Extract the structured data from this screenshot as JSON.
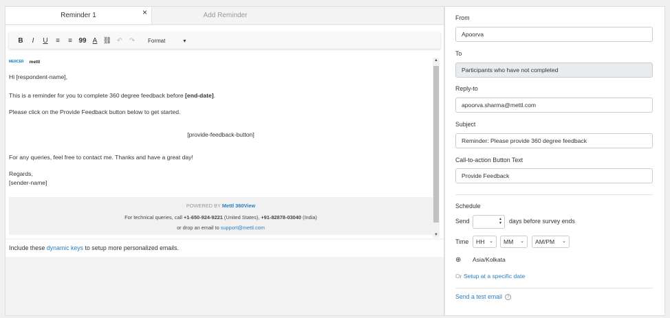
{
  "tabs": [
    {
      "label": "Reminder 1",
      "active": true
    },
    {
      "label": "Add Reminder",
      "active": false
    }
  ],
  "tab_close": "×",
  "toolbar": {
    "buttons": [
      "B",
      "I",
      "U",
      "≡",
      "≡",
      "99",
      "A",
      "⛓",
      "↶",
      "↷"
    ],
    "format_label": "Format",
    "format_chevron": "▾"
  },
  "email": {
    "logo_mercer": "MERCER",
    "logo_mettl": "mettl",
    "greeting": "Hi [respondent-name],",
    "line1_prefix": "This is a reminder for you to complete 360 degree feedback before ",
    "line1_bold": "[end-date]",
    "line1_suffix": ".",
    "line2": "Please click on the Provide Feedback button below to get started.",
    "button_placeholder": "[provide-feedback-button]",
    "line3": "For any queries, feel free to contact me. Thanks and have a great day!",
    "regards": "Regards,",
    "sender": "[sender-name]",
    "footer": {
      "powered_by": "POWERED BY ",
      "powered_brand": "Mettl 360View",
      "tech_prefix": "For technical queries, call ",
      "phone_us": "+1-650-924-9221",
      "us_label": " (United States), ",
      "phone_in": "+91-82878-03040",
      "in_label": " (India)",
      "drop_prefix": "or drop an email to ",
      "support_email": "support@mettl.com"
    }
  },
  "keys_hint": {
    "prefix": "Include these ",
    "link": "dynamic keys",
    "suffix": " to setup more personalized emails."
  },
  "form": {
    "from_label": "From",
    "from_value": "Apoorva",
    "to_label": "To",
    "to_value": "Participants who have not completed",
    "reply_label": "Reply-to",
    "reply_value": "apoorva.sharma@mettl.com",
    "subject_label": "Subject",
    "subject_value": "Reminder: Please provide 360 degree feedback",
    "cta_label": "Call-to-action Button Text",
    "cta_value": "Provide Feedback"
  },
  "schedule": {
    "title": "Schedule",
    "send_label": "Send",
    "days_suffix": "days before survey ends",
    "time_label": "Time",
    "hour": "HH",
    "minute": "MM",
    "ampm": "AM/PM",
    "timezone": "Asia/Kolkata",
    "or_prefix": "Or ",
    "specific_date_link": "Setup at a specific date",
    "test_email_link": "Send a test email"
  },
  "colors": {
    "link": "#2a7fc1",
    "disabled_bg": "#e9ecef"
  }
}
